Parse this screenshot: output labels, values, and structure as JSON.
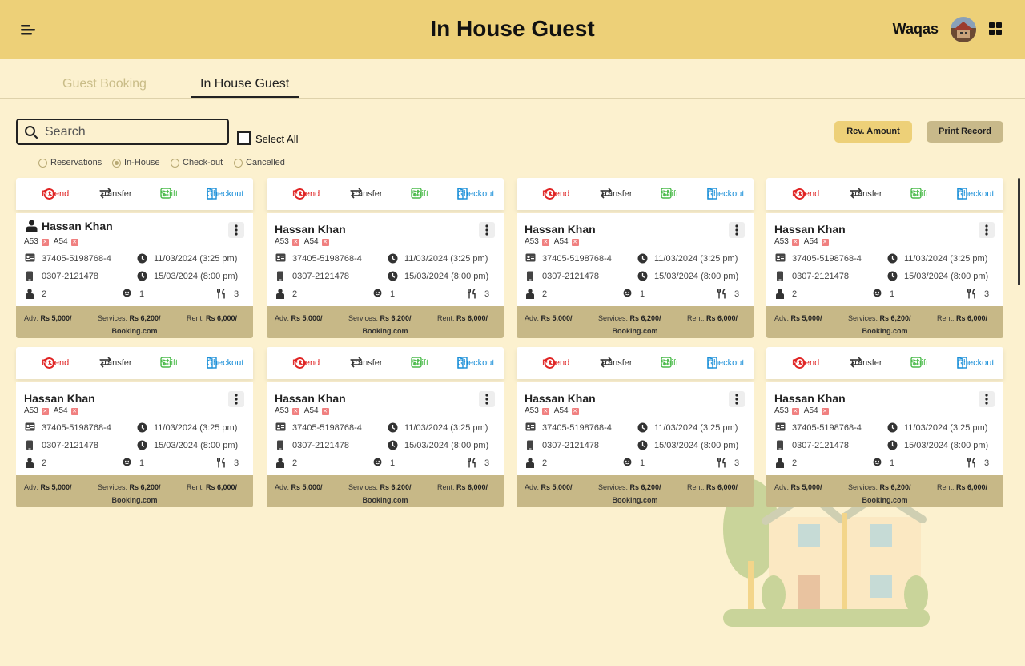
{
  "header": {
    "title": "In House Guest",
    "user_name": "Waqas"
  },
  "tabs": [
    {
      "label": "Guest Booking",
      "active": false
    },
    {
      "label": "In House Guest",
      "active": true
    }
  ],
  "search": {
    "placeholder": "Search"
  },
  "select_all_label": "Select All",
  "filters": [
    {
      "label": "Reservations",
      "selected": false
    },
    {
      "label": "In-House",
      "selected": true
    },
    {
      "label": "Check-out",
      "selected": false
    },
    {
      "label": "Cancelled",
      "selected": false
    }
  ],
  "buttons": {
    "rcv_amount": "Rcv. Amount",
    "print_record": "Print Record"
  },
  "card_actions": {
    "extend": "Extend",
    "transfer": "Transfer",
    "shift": "Shift",
    "checkout": "Checkout"
  },
  "guest_cards": [
    {
      "name": "Hassan Khan",
      "rooms": [
        "A53",
        "A54"
      ],
      "cnic": "37405-5198768-4",
      "phone": "0307-2121478",
      "check_in": "11/03/2024 (3:25 pm)",
      "check_out": "15/03/2024 (8:00 pm)",
      "adults": "2",
      "children": "1",
      "meals": "3",
      "adv_label": "Adv:",
      "adv": "Rs 5,000/",
      "services_label": "Services:",
      "services": "Rs 6,200/",
      "rent_label": "Rent:",
      "rent": "Rs 6,000/",
      "source": "Booking.com"
    },
    {
      "name": "Hassan Khan",
      "rooms": [
        "A53",
        "A54"
      ],
      "cnic": "37405-5198768-4",
      "phone": "0307-2121478",
      "check_in": "11/03/2024 (3:25 pm)",
      "check_out": "15/03/2024 (8:00 pm)",
      "adults": "2",
      "children": "1",
      "meals": "3",
      "adv_label": "Adv:",
      "adv": "Rs 5,000/",
      "services_label": "Services:",
      "services": "Rs 6,200/",
      "rent_label": "Rent:",
      "rent": "Rs 6,000/",
      "source": "Booking.com"
    },
    {
      "name": "Hassan Khan",
      "rooms": [
        "A53",
        "A54"
      ],
      "cnic": "37405-5198768-4",
      "phone": "0307-2121478",
      "check_in": "11/03/2024 (3:25 pm)",
      "check_out": "15/03/2024 (8:00 pm)",
      "adults": "2",
      "children": "1",
      "meals": "3",
      "adv_label": "Adv:",
      "adv": "Rs 5,000/",
      "services_label": "Services:",
      "services": "Rs 6,200/",
      "rent_label": "Rent:",
      "rent": "Rs 6,000/",
      "source": "Booking.com"
    },
    {
      "name": "Hassan Khan",
      "rooms": [
        "A53",
        "A54"
      ],
      "cnic": "37405-5198768-4",
      "phone": "0307-2121478",
      "check_in": "11/03/2024 (3:25 pm)",
      "check_out": "15/03/2024 (8:00 pm)",
      "adults": "2",
      "children": "1",
      "meals": "3",
      "adv_label": "Adv:",
      "adv": "Rs 5,000/",
      "services_label": "Services:",
      "services": "Rs 6,200/",
      "rent_label": "Rent:",
      "rent": "Rs 6,000/",
      "source": "Booking.com"
    },
    {
      "name": "Hassan Khan",
      "rooms": [
        "A53",
        "A54"
      ],
      "cnic": "37405-5198768-4",
      "phone": "0307-2121478",
      "check_in": "11/03/2024 (3:25 pm)",
      "check_out": "15/03/2024 (8:00 pm)",
      "adults": "2",
      "children": "1",
      "meals": "3",
      "adv_label": "Adv:",
      "adv": "Rs 5,000/",
      "services_label": "Services:",
      "services": "Rs 6,200/",
      "rent_label": "Rent:",
      "rent": "Rs 6,000/",
      "source": "Booking.com"
    },
    {
      "name": "Hassan Khan",
      "rooms": [
        "A53",
        "A54"
      ],
      "cnic": "37405-5198768-4",
      "phone": "0307-2121478",
      "check_in": "11/03/2024 (3:25 pm)",
      "check_out": "15/03/2024 (8:00 pm)",
      "adults": "2",
      "children": "1",
      "meals": "3",
      "adv_label": "Adv:",
      "adv": "Rs 5,000/",
      "services_label": "Services:",
      "services": "Rs 6,200/",
      "rent_label": "Rent:",
      "rent": "Rs 6,000/",
      "source": "Booking.com"
    },
    {
      "name": "Hassan Khan",
      "rooms": [
        "A53",
        "A54"
      ],
      "cnic": "37405-5198768-4",
      "phone": "0307-2121478",
      "check_in": "11/03/2024 (3:25 pm)",
      "check_out": "15/03/2024 (8:00 pm)",
      "adults": "2",
      "children": "1",
      "meals": "3",
      "adv_label": "Adv:",
      "adv": "Rs 5,000/",
      "services_label": "Services:",
      "services": "Rs 6,200/",
      "rent_label": "Rent:",
      "rent": "Rs 6,000/",
      "source": "Booking.com"
    },
    {
      "name": "Hassan Khan",
      "rooms": [
        "A53",
        "A54"
      ],
      "cnic": "37405-5198768-4",
      "phone": "0307-2121478",
      "check_in": "11/03/2024 (3:25 pm)",
      "check_out": "15/03/2024 (8:00 pm)",
      "adults": "2",
      "children": "1",
      "meals": "3",
      "adv_label": "Adv:",
      "adv": "Rs 5,000/",
      "services_label": "Services:",
      "services": "Rs 6,200/",
      "rent_label": "Rent:",
      "rent": "Rs 6,000/",
      "source": "Booking.com"
    }
  ],
  "colors": {
    "header_bg": "#edd078",
    "page_bg": "#fcf1cf",
    "card_footer": "#c7b887",
    "extend": "#e02424",
    "shift": "#4cbb4c",
    "checkout": "#1a8fd8"
  },
  "icons": {
    "menu": "menu-icon",
    "grid": "grid-icon",
    "search": "search-icon",
    "extend": "history-icon",
    "transfer": "swap-arrows-icon",
    "shift": "swap-square-icon",
    "checkout": "door-exit-icon"
  }
}
